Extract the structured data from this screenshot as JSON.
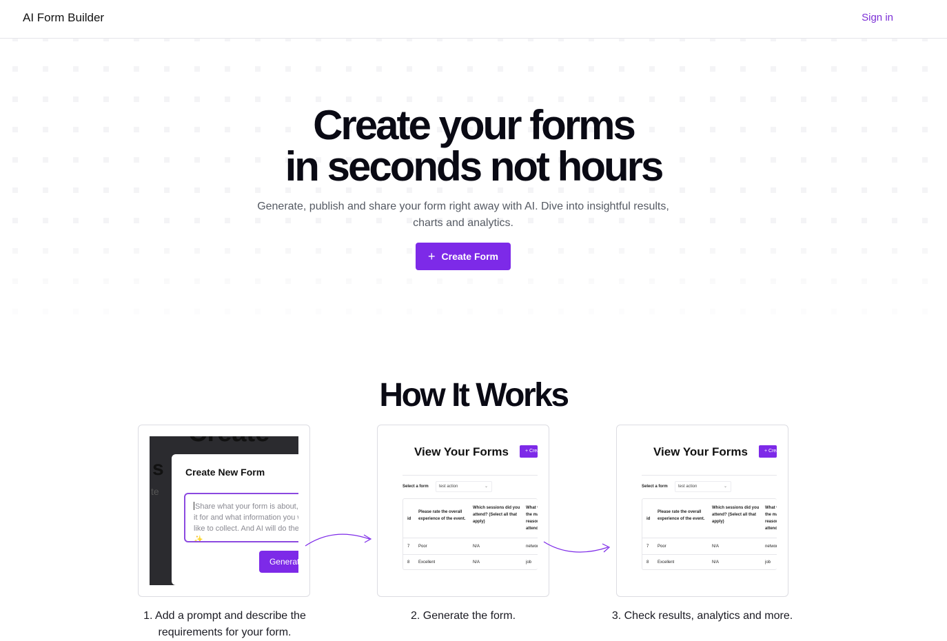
{
  "nav": {
    "brand": "AI Form Builder",
    "signin": "Sign in"
  },
  "hero": {
    "title_line1": "Create your forms",
    "title_line2": "in seconds not hours",
    "subtitle": "Generate, publish and share your form right away with AI. Dive into insightful results, charts and analytics.",
    "cta_label": "Create Form"
  },
  "how": {
    "title": "How It Works",
    "steps": [
      {
        "caption": "1. Add a prompt and describe the requirements for your form."
      },
      {
        "caption": "2. Generate the form."
      },
      {
        "caption": "3. Check results, analytics and more."
      }
    ]
  },
  "preview_create": {
    "modal_title": "Create New Form",
    "placeholder": "Share what your form is about, who is it for and what information you would like to collect. And AI will do the magic ✨",
    "generate_label": "Generate",
    "ghost_title": "Create your",
    "ghost_letter": "s",
    "ghost_text": "te"
  },
  "preview_forms": {
    "title": "View Your Forms",
    "button_label": "+ Create Form",
    "select_label": "Select a form",
    "select_value": "test action",
    "table": {
      "headers": [
        "id",
        "Please rate the overall experience of the event.",
        "Which sessions did you attend? (Select all that apply)",
        "What was the main reason for attending the event?"
      ],
      "rows": [
        [
          "7",
          "Poor",
          "N/A",
          "networking"
        ],
        [
          "8",
          "Excellent",
          "N/A",
          "job"
        ]
      ]
    }
  },
  "colors": {
    "accent": "#7d2ae8",
    "link": "#7c2fd6"
  },
  "icons": {
    "cta": "plus-icon",
    "select": "chevron-down-icon",
    "flow": "curved-arrow-icon"
  }
}
